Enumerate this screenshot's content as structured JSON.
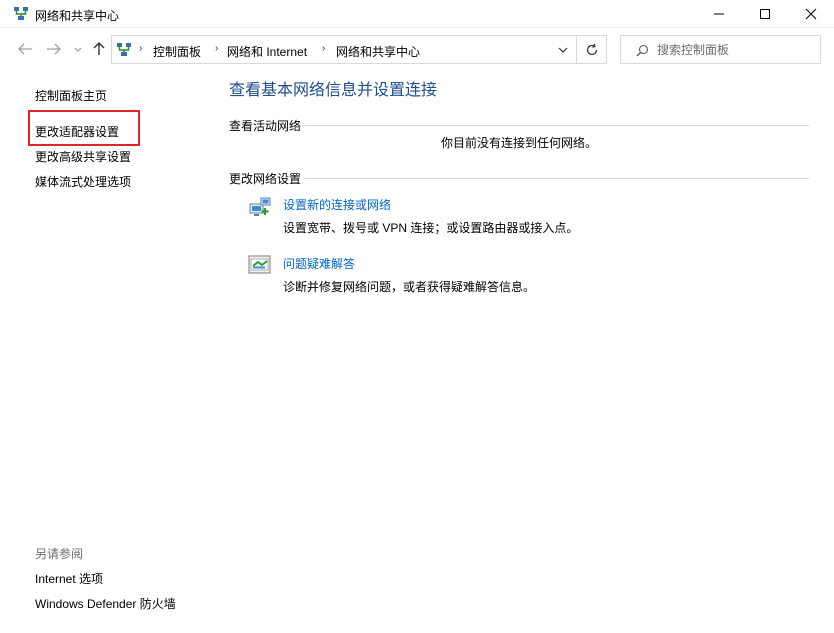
{
  "window": {
    "title": "网络和共享中心"
  },
  "nav": {
    "breadcrumbs": [
      "控制面板",
      "网络和 Internet",
      "网络和共享中心"
    ]
  },
  "search": {
    "placeholder": "搜索控制面板"
  },
  "sidebar": {
    "links": [
      "控制面板主页",
      "更改适配器设置",
      "更改高级共享设置",
      "媒体流式处理选项"
    ],
    "see_also_heading": "另请参阅",
    "see_also_links": [
      "Internet 选项",
      "Windows Defender 防火墙"
    ]
  },
  "main": {
    "title": "查看基本网络信息并设置连接",
    "active_networks": {
      "heading": "查看活动网络",
      "status": "你目前没有连接到任何网络。"
    },
    "change_settings": {
      "heading": "更改网络设置",
      "tasks": [
        {
          "icon": "new-connection-icon",
          "label": "设置新的连接或网络",
          "description": "设置宽带、拨号或 VPN 连接；或设置路由器或接入点。"
        },
        {
          "icon": "troubleshoot-icon",
          "label": "问题疑难解答",
          "description": "诊断并修复网络问题，或者获得疑难解答信息。"
        }
      ]
    }
  },
  "colors": {
    "title_blue": "#1e4e8c",
    "link_blue": "#0066cc",
    "highlight_red": "#e0242a"
  }
}
